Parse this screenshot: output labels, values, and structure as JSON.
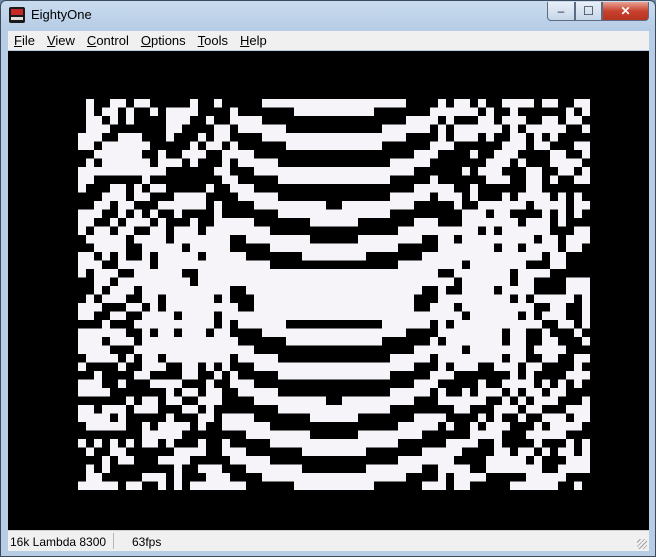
{
  "window": {
    "title": "EightyOne",
    "icon": "zx81-icon",
    "controls": {
      "minimize": "–",
      "maximize": "☐",
      "close": "✕"
    }
  },
  "menu": [
    {
      "key": "F",
      "rest": "ile"
    },
    {
      "key": "V",
      "rest": "iew"
    },
    {
      "key": "C",
      "rest": "ontrol"
    },
    {
      "key": "O",
      "rest": "ptions"
    },
    {
      "key": "T",
      "rest": "ools"
    },
    {
      "key": "H",
      "rest": "elp"
    }
  ],
  "status": {
    "model": "16k Lambda 8300",
    "fps": "63fps"
  },
  "colors": {
    "screen_bg": "#000000",
    "pixel": "#f6f4f8"
  }
}
